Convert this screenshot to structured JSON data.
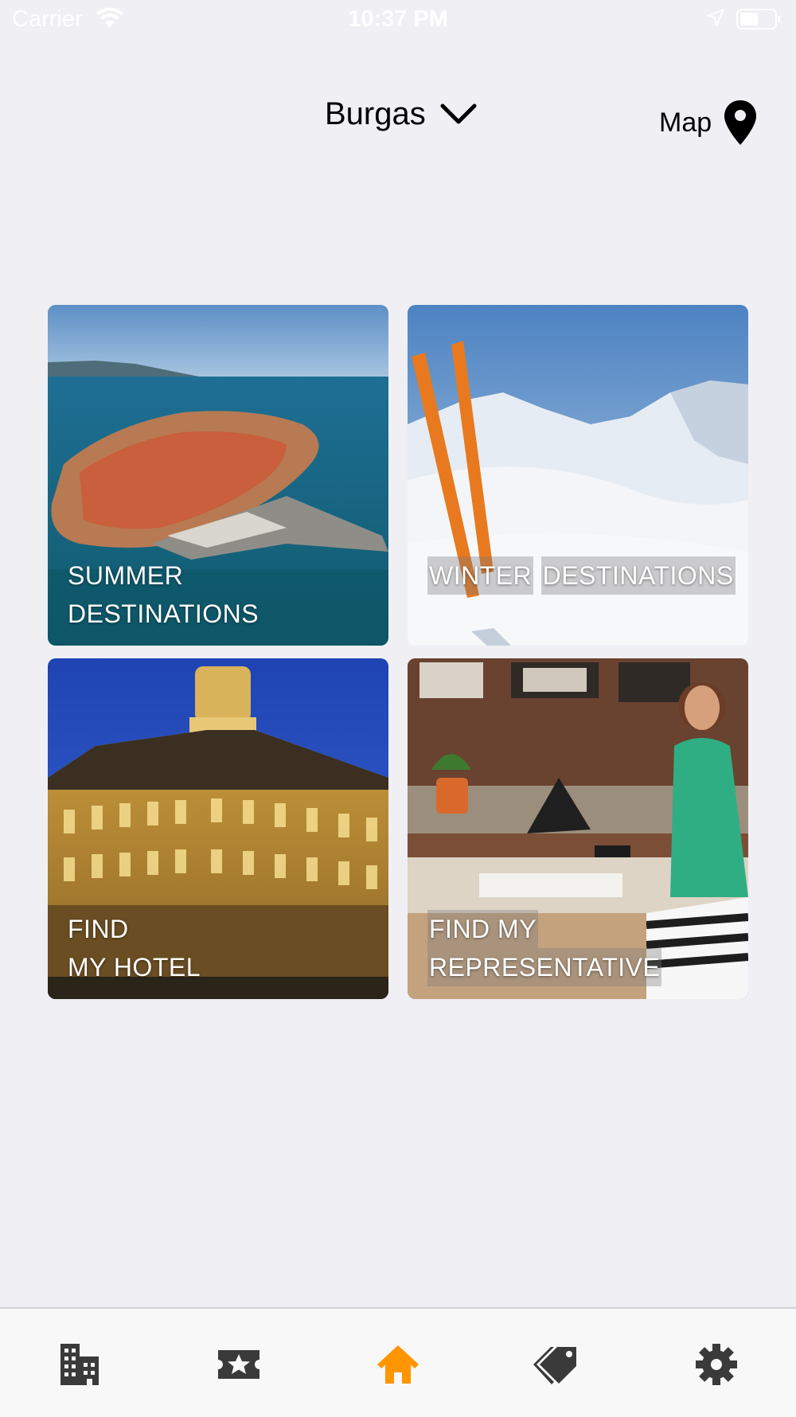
{
  "status_bar": {
    "carrier": "Carrier",
    "time": "10:37 PM",
    "icons": [
      "wifi-icon",
      "location-arrow-icon",
      "battery-icon"
    ]
  },
  "header": {
    "city": "Burgas",
    "city_dropdown_icon": "chevron-down-icon",
    "map_label": "Map",
    "map_icon": "map-pin-icon"
  },
  "tiles": [
    {
      "line1": "SUMMER",
      "line2": "DESTINATIONS"
    },
    {
      "line1": "WINTER",
      "line2": "DESTINATIONS"
    },
    {
      "line1": "FIND",
      "line2": "MY HOTEL"
    },
    {
      "line1": "FIND MY",
      "line2": "REPRESENTATIVE"
    }
  ],
  "tab_bar": {
    "items": [
      {
        "icon": "hotel-building-icon",
        "selected": false
      },
      {
        "icon": "star-ticket-icon",
        "selected": false
      },
      {
        "icon": "home-icon",
        "selected": true
      },
      {
        "icon": "tags-icon",
        "selected": false
      },
      {
        "icon": "gear-icon",
        "selected": false
      }
    ],
    "active_color": "#ff9500",
    "inactive_color": "#3a3a3a"
  }
}
